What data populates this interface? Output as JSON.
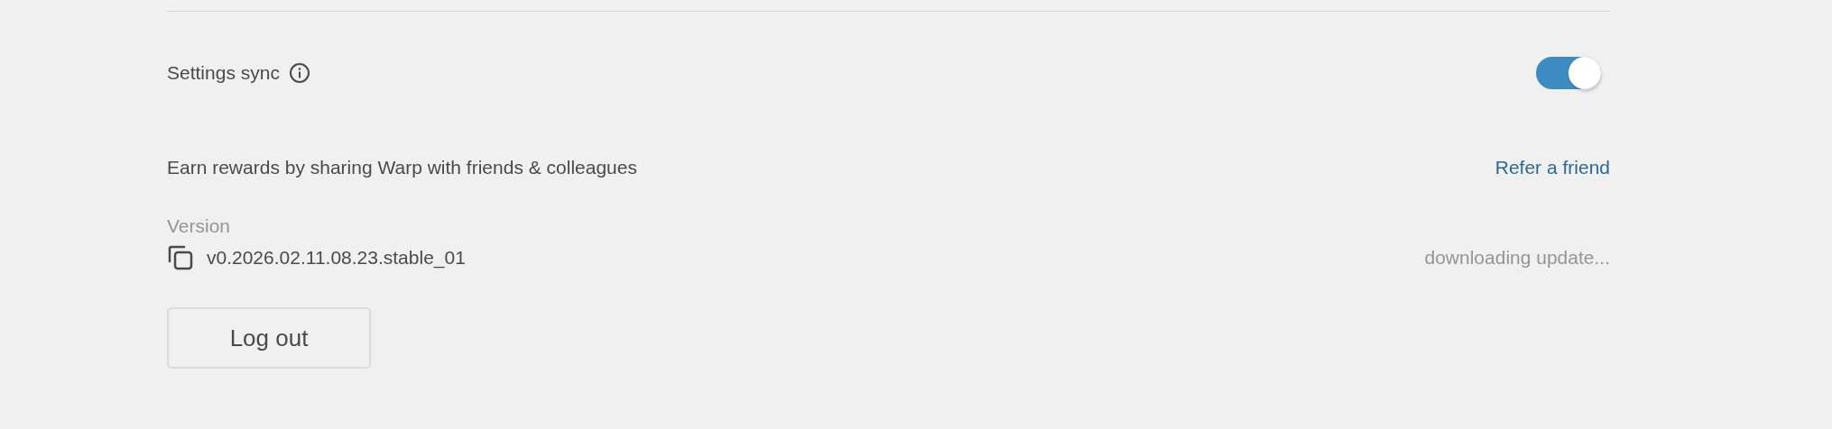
{
  "settings_sync": {
    "label": "Settings sync",
    "on": true
  },
  "referral": {
    "text": "Earn rewards by sharing Warp with friends & colleagues",
    "link": "Refer a friend"
  },
  "version": {
    "label": "Version",
    "value": "v0.2026.02.11.08.23.stable_01",
    "status": "downloading update..."
  },
  "logout_button": "Log out"
}
